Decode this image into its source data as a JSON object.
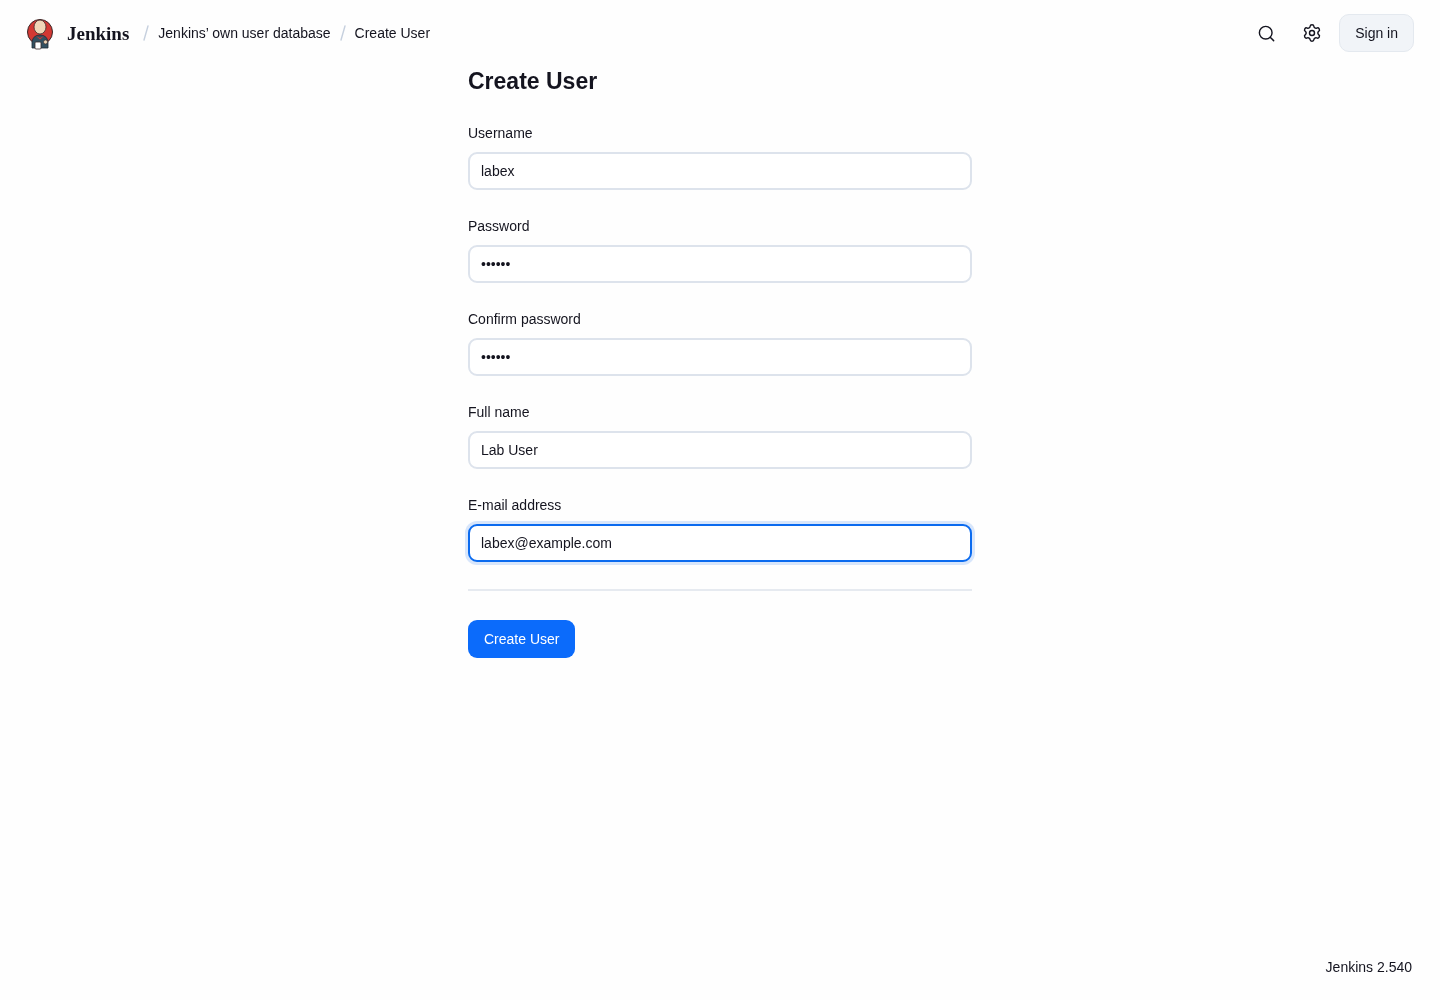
{
  "header": {
    "logo_text": "Jenkins",
    "breadcrumbs": [
      {
        "label": "Jenkins’ own user database"
      },
      {
        "label": "Create User"
      }
    ],
    "sign_in_button": "Sign in"
  },
  "title": "Create User",
  "fields": [
    {
      "label": "Username",
      "value": "labex",
      "focused": false
    },
    {
      "label": "Password",
      "value": "••••••",
      "focused": false
    },
    {
      "label": "Confirm password",
      "value": "••••••",
      "focused": false
    },
    {
      "label": "Full name",
      "value": "Lab User",
      "focused": false
    },
    {
      "label": "E-mail address",
      "value": "labex@example.com",
      "focused": true
    }
  ],
  "submit_button": "Create User",
  "footer": {
    "version": "Jenkins 2.540"
  }
}
